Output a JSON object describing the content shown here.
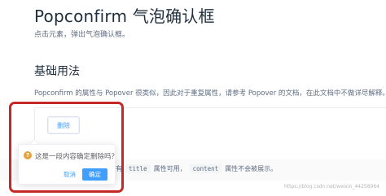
{
  "page": {
    "title": "Popconfirm 气泡确认框",
    "subtitle": "点击元素，弹出气泡确认框。"
  },
  "section": {
    "heading": "基础用法",
    "description": "Popconfirm 的属性与 Popover 很类似，因此对于重复属性，请参考 Popover 的文档，在此文档中不做详尽解释。"
  },
  "demo": {
    "delete_label": "删除"
  },
  "popconfirm": {
    "message": "这是一段内容确定删除吗？",
    "cancel_label": "取消",
    "confirm_label": "确定",
    "icon": "question-icon",
    "icon_color": "#e6a23c"
  },
  "band": {
    "prefix": "有",
    "code1": "title",
    "middle": "属性可用，",
    "code2": "content",
    "suffix": "属性不会被展示。"
  },
  "colors": {
    "accent": "#409eff",
    "highlight": "#c62828"
  },
  "watermark": "https://blog.csdn.net/weixin_44258964"
}
